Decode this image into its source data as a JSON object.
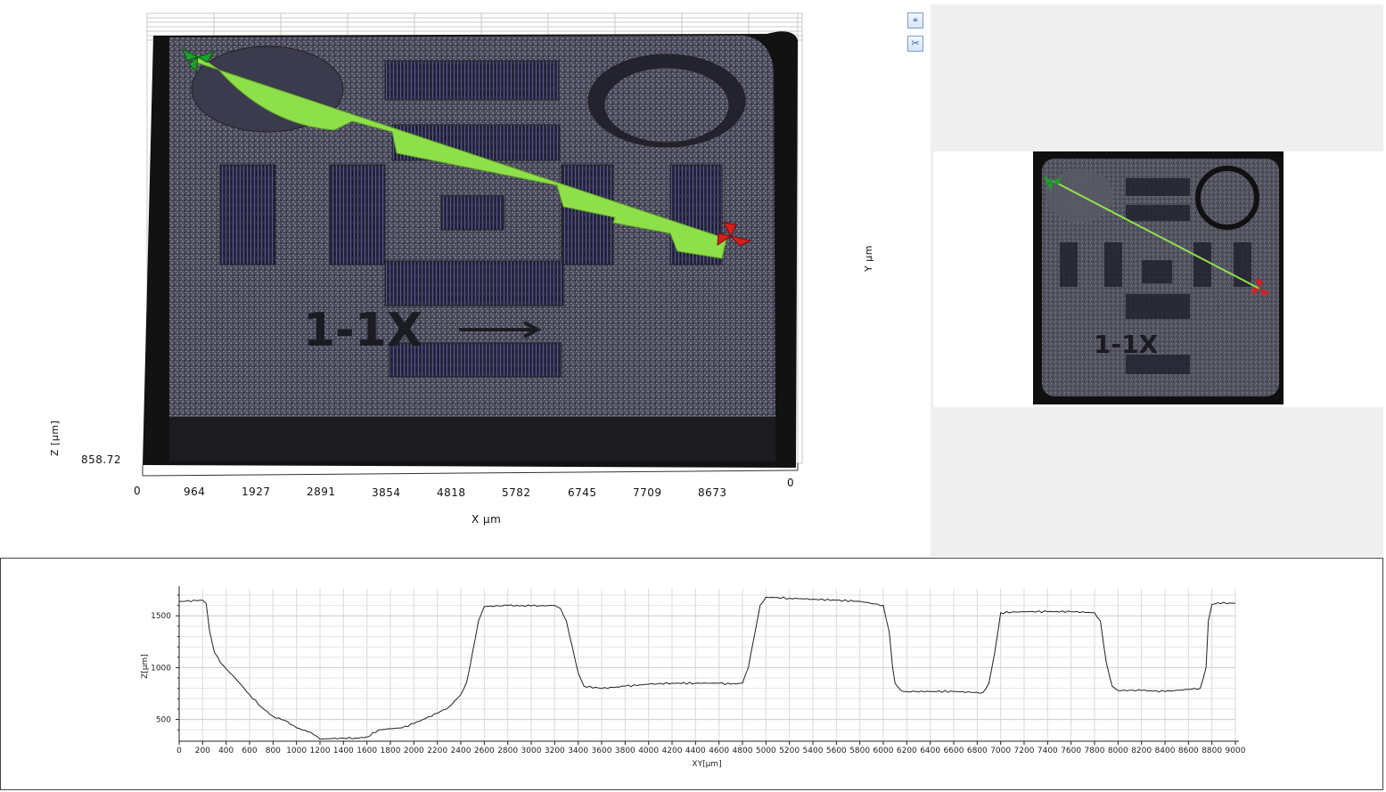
{
  "view3d": {
    "x_ticks": [
      "0",
      "964",
      "1927",
      "2891",
      "3854",
      "4818",
      "5782",
      "6745",
      "7709",
      "8673"
    ],
    "x_end": "0",
    "x_label": "X µm",
    "z_value": "858.72",
    "z_label": "Z [µm]",
    "y_label": "Y µm",
    "engraving": "1-1X"
  },
  "toolbar": {
    "buttons": [
      {
        "icon": "crosshair-move-icon",
        "glyph": "⌖"
      },
      {
        "icon": "scissors-icon",
        "glyph": "✂"
      }
    ]
  },
  "thumbnail": {
    "engraving": "1-1X"
  },
  "colors": {
    "profile_line": "#8ee04a",
    "start_marker": "#1f9e2a",
    "end_marker": "#d42020",
    "surface": "#3f3f4e"
  },
  "chart_data": {
    "type": "line",
    "xlabel": "XY[µm]",
    "ylabel": "Z[µm]",
    "xlim": [
      0,
      9000
    ],
    "ylim": [
      290,
      1760
    ],
    "x_ticks": [
      0,
      200,
      400,
      600,
      800,
      1000,
      1200,
      1400,
      1600,
      1800,
      2000,
      2200,
      2400,
      2600,
      2800,
      3000,
      3200,
      3400,
      3600,
      3800,
      4000,
      4200,
      4400,
      4600,
      4800,
      5000,
      5200,
      5400,
      5600,
      5800,
      6000,
      6200,
      6400,
      6600,
      6800,
      7000,
      7200,
      7400,
      7600,
      7800,
      8000,
      8200,
      8400,
      8600,
      8800,
      9000
    ],
    "y_ticks": [
      500,
      1000,
      1500
    ],
    "grid": true,
    "series": [
      {
        "x": [
          0,
          150,
          200,
          230,
          260,
          300,
          350,
          400,
          500,
          600,
          700,
          800,
          900,
          1000,
          1100,
          1150,
          1200,
          1300,
          1400,
          1500,
          1600,
          1700,
          1800,
          1900,
          2000,
          2100,
          2200,
          2300,
          2400,
          2450,
          2500,
          2550,
          2600,
          2800,
          3000,
          3200,
          3250,
          3300,
          3350,
          3400,
          3450,
          3600,
          3800,
          4000,
          4200,
          4400,
          4600,
          4700,
          4800,
          4850,
          4900,
          4950,
          5000,
          5200,
          5400,
          5600,
          5800,
          6000,
          6050,
          6080,
          6100,
          6150,
          6200,
          6400,
          6600,
          6800,
          6850,
          6900,
          6950,
          7000,
          7200,
          7400,
          7600,
          7800,
          7850,
          7900,
          7950,
          8000,
          8200,
          8400,
          8600,
          8700,
          8750,
          8770,
          8800,
          8850,
          9000
        ],
        "y": [
          1640,
          1645,
          1650,
          1620,
          1350,
          1150,
          1050,
          990,
          870,
          740,
          620,
          530,
          490,
          420,
          380,
          350,
          310,
          315,
          320,
          320,
          330,
          400,
          410,
          420,
          460,
          510,
          560,
          620,
          740,
          860,
          1150,
          1450,
          1590,
          1600,
          1595,
          1600,
          1570,
          1450,
          1200,
          950,
          820,
          800,
          820,
          840,
          850,
          850,
          850,
          840,
          850,
          1000,
          1300,
          1600,
          1680,
          1670,
          1660,
          1650,
          1640,
          1600,
          1350,
          1000,
          850,
          780,
          770,
          770,
          770,
          760,
          760,
          850,
          1150,
          1530,
          1540,
          1540,
          1540,
          1530,
          1450,
          1050,
          820,
          780,
          780,
          770,
          790,
          800,
          1000,
          1450,
          1610,
          1625,
          1620
        ]
      }
    ]
  }
}
